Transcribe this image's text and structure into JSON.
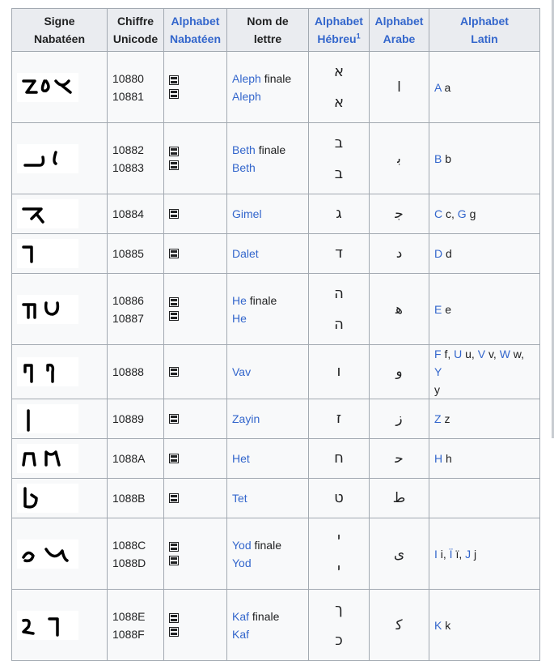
{
  "headers": {
    "signe": [
      "Signe",
      "Nabatéen"
    ],
    "unicode": [
      "Chiffre",
      "Unicode"
    ],
    "alph_nab": [
      "Alphabet",
      "Nabatéen"
    ],
    "nom": [
      "Nom de",
      "lettre"
    ],
    "alph_heb": [
      "Alphabet",
      "Hébreu"
    ],
    "alph_heb_note": "1",
    "alph_ar": [
      "Alphabet",
      "Arabe"
    ],
    "alph_lat": [
      "Alphabet",
      "Latin"
    ]
  },
  "rows": [
    {
      "codes": [
        "10880",
        "10881"
      ],
      "names": [
        {
          "link": "Aleph",
          "suffix": " finale"
        },
        {
          "link": "Aleph",
          "suffix": ""
        }
      ],
      "hebrew": [
        "א",
        "א"
      ],
      "arabic": "ا",
      "latin": [
        {
          "link": "A",
          "text": " a"
        }
      ],
      "icon": "nabataean-aleph-glyphs-icon"
    },
    {
      "codes": [
        "10882",
        "10883"
      ],
      "names": [
        {
          "link": "Beth",
          "suffix": " finale"
        },
        {
          "link": "Beth",
          "suffix": ""
        }
      ],
      "hebrew": [
        "ב",
        "ב"
      ],
      "arabic": "ﺑ",
      "latin": [
        {
          "link": "B",
          "text": " b"
        }
      ],
      "icon": "nabataean-beth-glyphs-icon"
    },
    {
      "codes": [
        "10884"
      ],
      "names": [
        {
          "link": "Gimel",
          "suffix": ""
        }
      ],
      "hebrew": [
        "ג"
      ],
      "arabic": "ﺟ",
      "latin": [
        {
          "link": "C",
          "text": " c, "
        },
        {
          "link": "G",
          "text": " g"
        }
      ],
      "icon": "nabataean-gimel-glyph-icon"
    },
    {
      "codes": [
        "10885"
      ],
      "names": [
        {
          "link": "Dalet",
          "suffix": ""
        }
      ],
      "hebrew": [
        "ד"
      ],
      "arabic": "د",
      "latin": [
        {
          "link": "D",
          "text": " d"
        }
      ],
      "icon": "nabataean-dalet-glyph-icon"
    },
    {
      "codes": [
        "10886",
        "10887"
      ],
      "names": [
        {
          "link": "He",
          "suffix": " finale"
        },
        {
          "link": "He",
          "suffix": ""
        }
      ],
      "hebrew": [
        "ה",
        "ה"
      ],
      "arabic": "ﻫ",
      "latin": [
        {
          "link": "E",
          "text": " e"
        }
      ],
      "icon": "nabataean-he-glyphs-icon"
    },
    {
      "codes": [
        "10888"
      ],
      "names": [
        {
          "link": "Vav",
          "suffix": ""
        }
      ],
      "hebrew": [
        "ו"
      ],
      "arabic": "و",
      "latin": [
        {
          "link": "F",
          "text": " f, "
        },
        {
          "link": "U",
          "text": " u, "
        },
        {
          "link": "V",
          "text": " v, "
        },
        {
          "link": "W",
          "text": " w, "
        },
        {
          "link": "Y",
          "text": ""
        }
      ],
      "latin_tail": "y",
      "icon": "nabataean-vav-glyphs-icon"
    },
    {
      "codes": [
        "10889"
      ],
      "names": [
        {
          "link": "Zayin",
          "suffix": ""
        }
      ],
      "hebrew": [
        "ז"
      ],
      "arabic": "ز",
      "latin": [
        {
          "link": "Z",
          "text": " z"
        }
      ],
      "icon": "nabataean-zayin-glyph-icon"
    },
    {
      "codes": [
        "1088A"
      ],
      "names": [
        {
          "link": "Het",
          "suffix": ""
        }
      ],
      "hebrew": [
        "ח"
      ],
      "arabic": "ﺣ",
      "latin": [
        {
          "link": "H",
          "text": " h"
        }
      ],
      "icon": "nabataean-het-glyphs-icon"
    },
    {
      "codes": [
        "1088B"
      ],
      "names": [
        {
          "link": "Tet",
          "suffix": ""
        }
      ],
      "hebrew": [
        "ט"
      ],
      "arabic": "ط",
      "latin": [],
      "icon": "nabataean-tet-glyph-icon"
    },
    {
      "codes": [
        "1088C",
        "1088D"
      ],
      "names": [
        {
          "link": "Yod",
          "suffix": " finale"
        },
        {
          "link": "Yod",
          "suffix": ""
        }
      ],
      "hebrew": [
        "י",
        "י"
      ],
      "arabic": "ى",
      "latin": [
        {
          "link": "I",
          "text": " i, "
        },
        {
          "link": "Ï",
          "text": " ï, "
        },
        {
          "link": "J",
          "text": " j"
        }
      ],
      "icon": "nabataean-yod-glyphs-icon"
    },
    {
      "codes": [
        "1088E",
        "1088F"
      ],
      "names": [
        {
          "link": "Kaf",
          "suffix": " finale"
        },
        {
          "link": "Kaf",
          "suffix": ""
        }
      ],
      "hebrew": [
        "ך",
        "כ"
      ],
      "arabic": "ﻛ",
      "latin": [
        {
          "link": "K",
          "text": " k"
        }
      ],
      "icon": "nabataean-kaf-glyphs-icon"
    }
  ]
}
